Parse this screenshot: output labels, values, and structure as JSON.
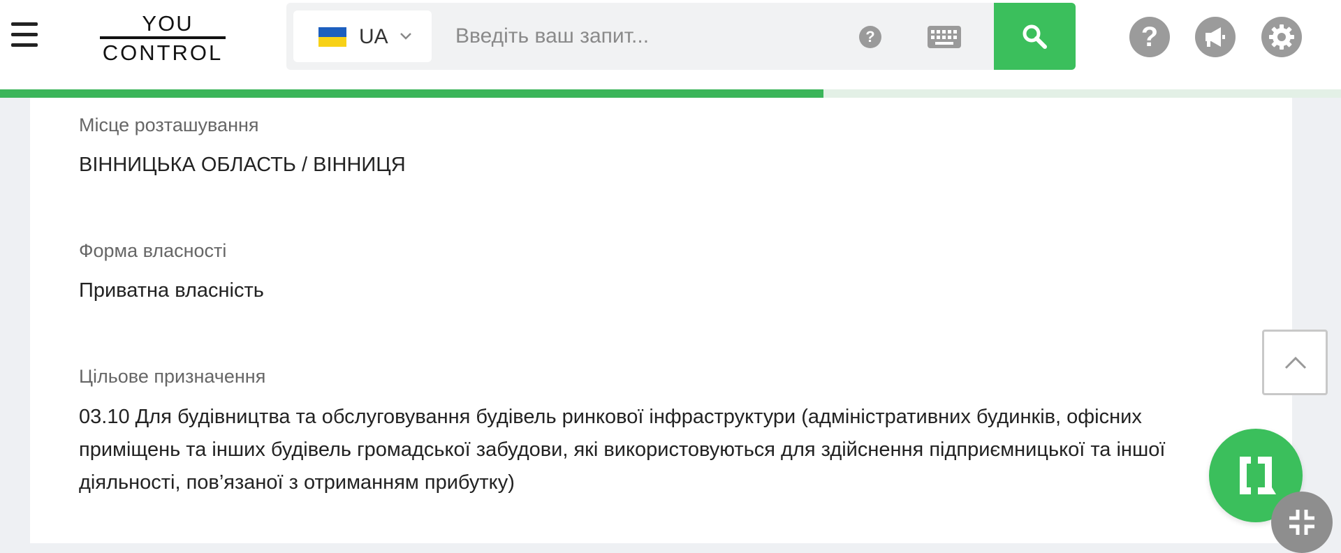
{
  "header": {
    "logo": {
      "line1": "YOU",
      "line2": "CONTROL"
    },
    "language": {
      "code": "UA",
      "flag_colors": [
        "#1d5fbf",
        "#f7d117"
      ]
    },
    "search": {
      "placeholder": "Введіть ваш запит...",
      "value": ""
    },
    "icons": {
      "menu": "hamburger-menu-icon",
      "search_help": "question-icon",
      "keyboard": "keyboard-icon",
      "search": "magnifier-icon",
      "help": "question-icon",
      "announce": "megaphone-icon",
      "settings": "gear-icon"
    },
    "accent_color": "#3bbf5c"
  },
  "progress": {
    "value_percent": 61.4
  },
  "fields": [
    {
      "label": "Місце розташування",
      "value": "ВІННИЦЬКА ОБЛАСТЬ / ВІННИЦЯ"
    },
    {
      "label": "Форма власності",
      "value": "Приватна власність"
    },
    {
      "label": "Цільове призначення",
      "value": "03.10 Для будівництва та обслуговування будівель ринкової інфраструктури (адміністративних будинків, офісних приміщень та інших будівель громадської забудови, які використовуються для здійснення підприємницької та іншої діяльності, пов’язаної з отриманням прибутку)"
    }
  ],
  "floating": {
    "scroll_top_icon": "chevron-up-icon",
    "chat_icon": "chat-bracket-icon",
    "collapse_icon": "collapse-arrows-icon"
  }
}
